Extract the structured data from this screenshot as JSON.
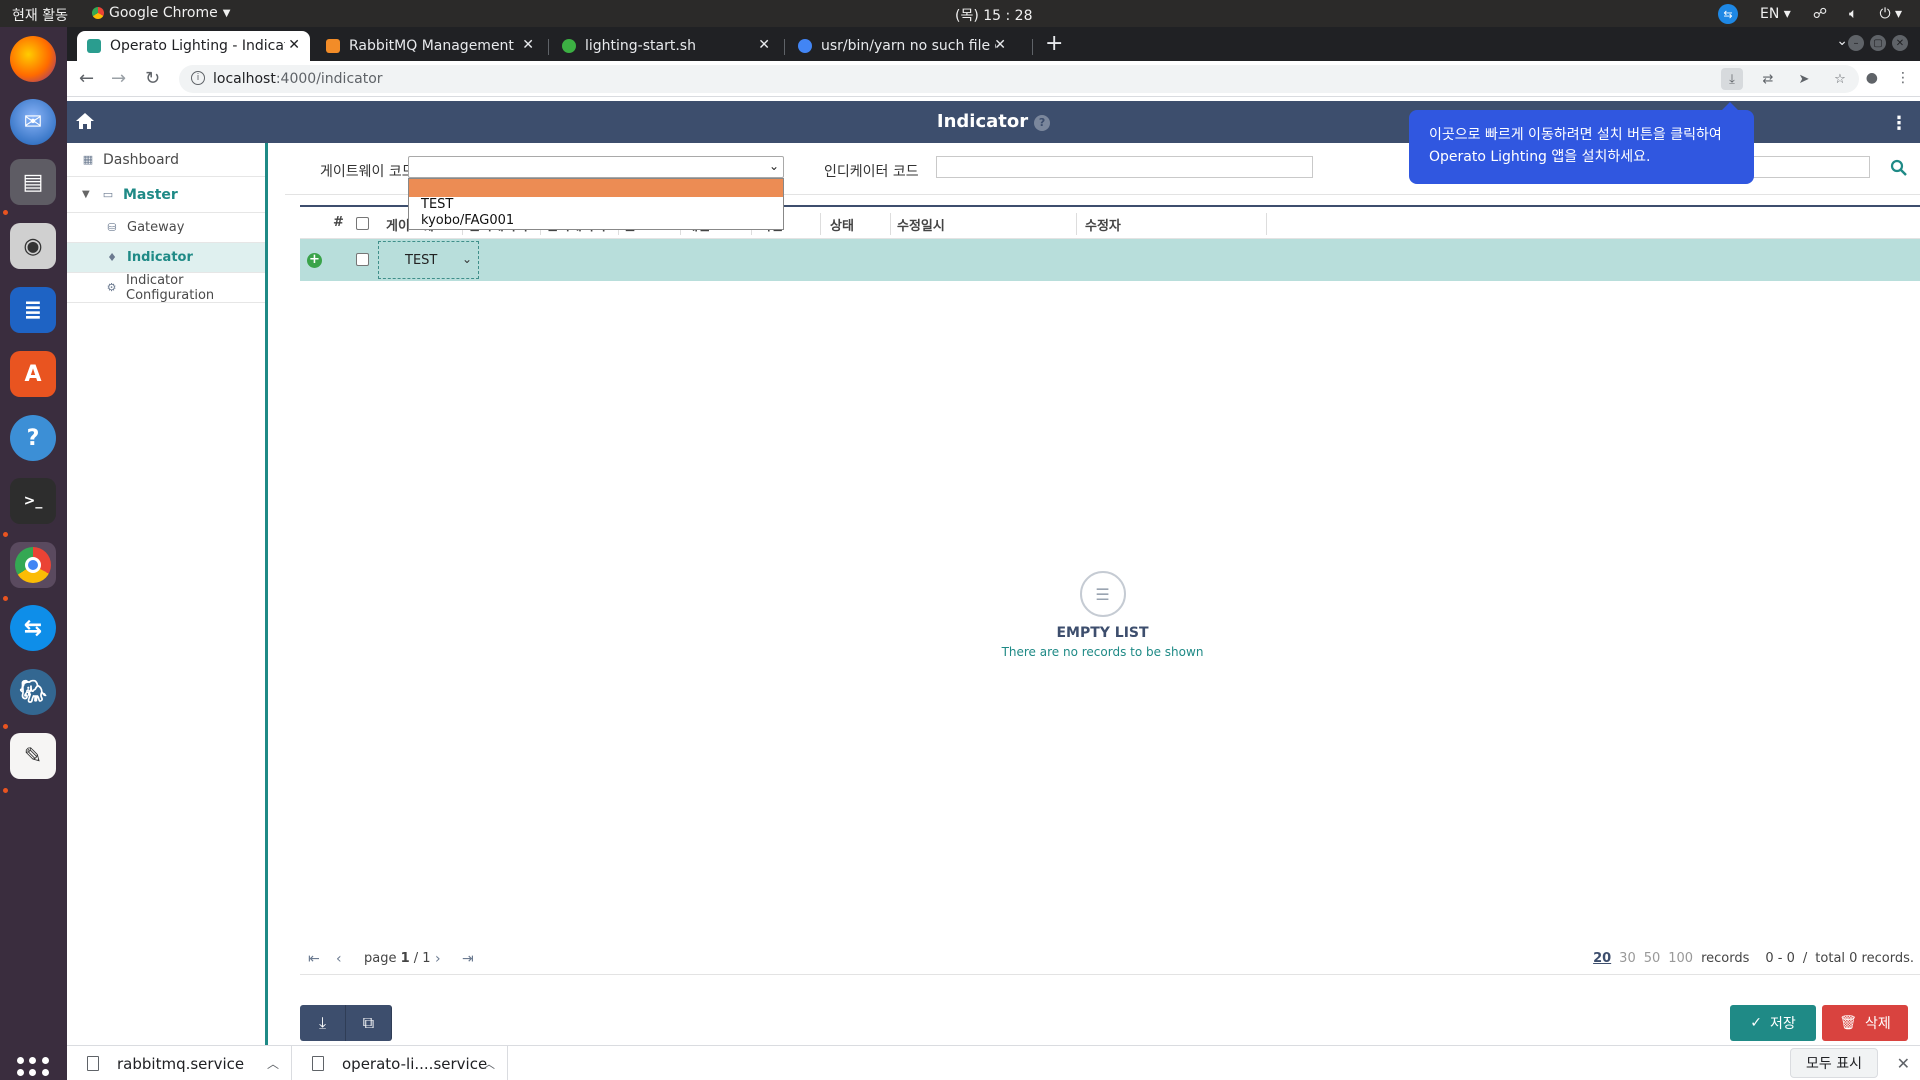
{
  "os": {
    "activities": "현재 활동",
    "app_name": "Google Chrome",
    "clock": "(목) 15 : 28",
    "lang": "EN",
    "dock": [
      "firefox-icon",
      "thunderbird-icon",
      "files-icon",
      "rhythmbox-icon",
      "writer-icon",
      "software-icon",
      "help-icon",
      "terminal-icon",
      "chrome-icon",
      "teamviewer-icon",
      "postgres-icon",
      "text-editor-icon"
    ]
  },
  "browser": {
    "tabs": [
      {
        "title": "Operato Lighting - Indicat",
        "color": "#2a9d8f",
        "active": true
      },
      {
        "title": "RabbitMQ Management",
        "color": "#f28c28",
        "active": false
      },
      {
        "title": "lighting-start.sh",
        "color": "#3cb043",
        "active": false
      },
      {
        "title": "usr/bin/yarn no such file o",
        "color": "#4285f4",
        "active": false
      }
    ],
    "url_host": "localhost",
    "url_path": ":4000/indicator"
  },
  "app": {
    "title": "Indicator",
    "help": "?",
    "install_tip_line1": "이곳으로 빠르게 이동하려면 설치 버튼을 클릭하여",
    "install_tip_line2": "Operato Lighting 앱을 설치하세요.",
    "sidebar": {
      "dashboard": "Dashboard",
      "master": "Master",
      "items": [
        "Gateway",
        "Indicator",
        "Indicator Configuration"
      ]
    },
    "filter": {
      "gateway_label": "게이트웨이 코드",
      "indicator_label": "인디케이터 코드",
      "gateway_options": [
        "",
        "TEST",
        "kyobo/FAG001"
      ]
    },
    "grid": {
      "columns": [
        "#",
        "게이트웨...",
        "인디케이터...",
        "인디케이터...",
        "존코드",
        "채널코드",
        "버전",
        "상태",
        "수정일시",
        "수정자"
      ],
      "new_row_gateway": "TEST"
    },
    "empty": {
      "title": "EMPTY LIST",
      "subtitle": "There are no records to be shown"
    },
    "pager": {
      "page_label": "page",
      "page_current": "1",
      "page_total": "/ 1",
      "sizes": [
        "20",
        "30",
        "50",
        "100"
      ],
      "records_label": "records",
      "range": "0 - 0",
      "slash": "/",
      "total": "total 0 records."
    },
    "buttons": {
      "save": "저장",
      "delete": "삭제"
    }
  },
  "downloads": {
    "items": [
      "rabbitmq.service",
      "operato-li....service"
    ],
    "show_all": "모두 표시"
  }
}
